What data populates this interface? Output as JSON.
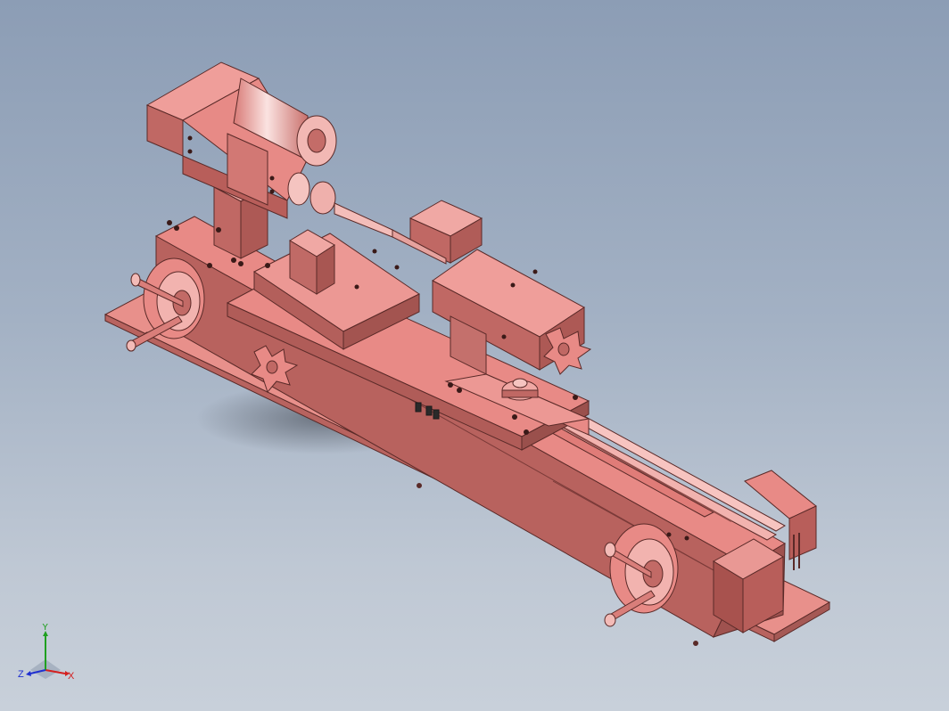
{
  "viewport": {
    "background_top": "#8c9db5",
    "background_bottom": "#c8d0da",
    "part_color": "#e88a86",
    "part_shadow": "#b86a66",
    "part_edge": "#5a2a28"
  },
  "triad": {
    "x_label": "X",
    "y_label": "Y",
    "z_label": "Z",
    "x_color": "#d42020",
    "y_color": "#20a020",
    "z_color": "#2030d0"
  }
}
